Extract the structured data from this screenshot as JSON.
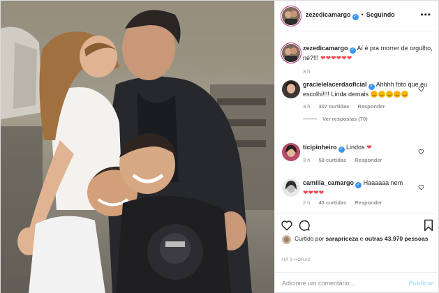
{
  "post": {
    "author": "zezedicamargo",
    "follow_status": "Seguindo",
    "more_label": "•••",
    "caption": {
      "username": "zezedicamargo",
      "text": "Aí é pra morrer de orgulho, né?!!!",
      "emoji": "❤❤❤❤❤❤",
      "age": "3 h"
    },
    "comments": [
      {
        "username": "gracielelacerdaoficial",
        "verified": true,
        "text": "Ahhhh foto que eu escolhi!!!! Linda demais",
        "age": "3 h",
        "likes": "307 curtidas",
        "reply": "Responder",
        "view_replies": "Ver respostas (70)"
      },
      {
        "username": "ticipinheiro",
        "verified": true,
        "text": "Lindos",
        "emoji": "❤",
        "age": "3 h",
        "likes": "58 curtidas",
        "reply": "Responder"
      },
      {
        "username": "camilla_camargo",
        "verified": true,
        "text": "Haaaaaa nem",
        "emoji": "❤❤❤❤",
        "age": "2 h",
        "likes": "43 curtidas",
        "reply": "Responder"
      }
    ],
    "liked_by_prefix": "Curtido por",
    "liked_by_user": "sarapriceza",
    "liked_by_connector": "e",
    "liked_by_others": "outras 43.970 pessoas",
    "timestamp": "HÁ 3 HORAS",
    "comment_placeholder": "Adicione um comentário...",
    "publish_label": "Publicar"
  },
  "icons": {
    "heart": "heart-icon",
    "comment": "comment-icon",
    "save": "bookmark-icon",
    "verified": "verified-badge-icon"
  },
  "colors": {
    "verified_blue": "#3897f0",
    "emoji_red": "#ed4956",
    "muted_gray": "#8e8e8e",
    "publish_disabled": "#b2dffc"
  }
}
